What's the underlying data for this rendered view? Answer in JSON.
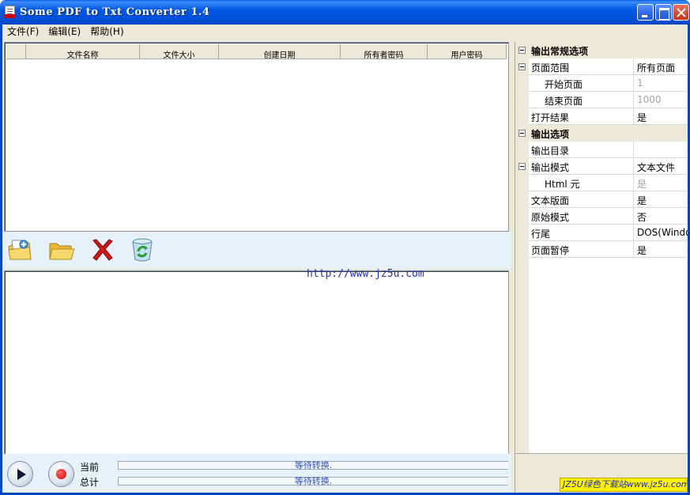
{
  "window": {
    "title": "Some PDF to Txt Converter 1.4"
  },
  "menu": [
    {
      "label": "文件(F)"
    },
    {
      "label": "编辑(E)"
    },
    {
      "label": "帮助(H)"
    }
  ],
  "file_table": {
    "columns": [
      "文件名称",
      "文件大小",
      "创建日期",
      "所有者密码",
      "用户密码"
    ],
    "rows": []
  },
  "toolbar": {
    "buttons": [
      {
        "icon": "add-file-icon"
      },
      {
        "icon": "open-folder-icon"
      },
      {
        "icon": "delete-icon"
      },
      {
        "icon": "recycle-bin-icon"
      }
    ]
  },
  "log": {
    "url": "http://www.jz5u.com"
  },
  "progress": {
    "current_label": "当前",
    "current_status": "等待转换.",
    "total_label": "总计",
    "total_status": "等待转换."
  },
  "properties": [
    {
      "type": "category",
      "label": "输出常规选项"
    },
    {
      "type": "prop",
      "name": "页面范围",
      "value": "所有页面",
      "expandable": true
    },
    {
      "type": "prop",
      "name": "开始页面",
      "value": "1",
      "indent": true,
      "disabled": true
    },
    {
      "type": "prop",
      "name": "结束页面",
      "value": "1000",
      "indent": true,
      "disabled": true
    },
    {
      "type": "prop",
      "name": "打开结果",
      "value": "是"
    },
    {
      "type": "category",
      "label": "输出选项"
    },
    {
      "type": "prop",
      "name": "输出目录",
      "value": ""
    },
    {
      "type": "prop",
      "name": "输出模式",
      "value": "文本文件",
      "expandable": true
    },
    {
      "type": "prop",
      "name": "Html 元",
      "value": "是",
      "indent": true,
      "disabled": true
    },
    {
      "type": "prop",
      "name": "文本版面",
      "value": "是"
    },
    {
      "type": "prop",
      "name": "原始模式",
      "value": "否"
    },
    {
      "type": "prop",
      "name": "行尾",
      "value": "DOS(Windo"
    },
    {
      "type": "prop",
      "name": "页面暂停",
      "value": "是"
    }
  ],
  "badge": {
    "text": "JZ5U绿色下载站www.jz5u.com"
  }
}
